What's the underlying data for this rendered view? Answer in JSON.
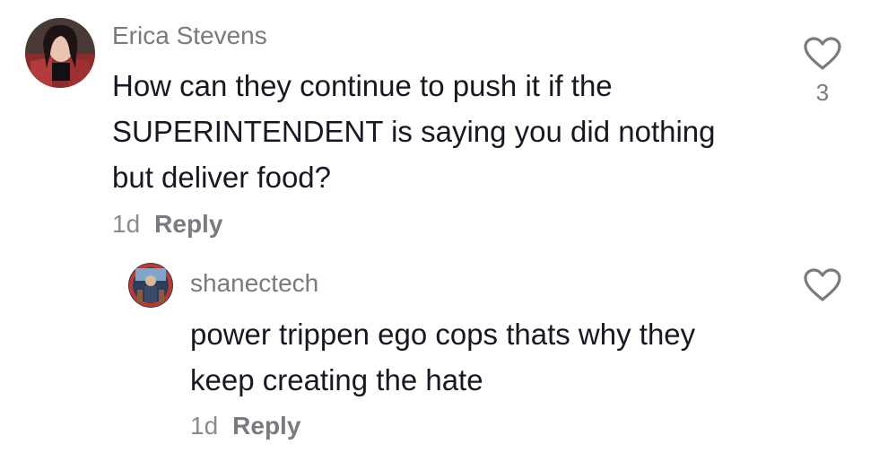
{
  "comments": [
    {
      "username": "Erica Stevens",
      "text_lines": [
        "How can they continue to push it if the",
        "SUPERINTENDENT is saying you did nothing",
        "but deliver food?"
      ],
      "time": "1d",
      "reply_label": "Reply",
      "like_count": "3",
      "avatar_icon": "user-avatar",
      "like_icon": "heart-outline-icon"
    },
    {
      "username": "shanectech",
      "text_lines": [
        "power trippen ego cops thats why they",
        "keep creating the hate"
      ],
      "time": "1d",
      "reply_label": "Reply",
      "like_icon": "heart-outline-icon"
    }
  ]
}
